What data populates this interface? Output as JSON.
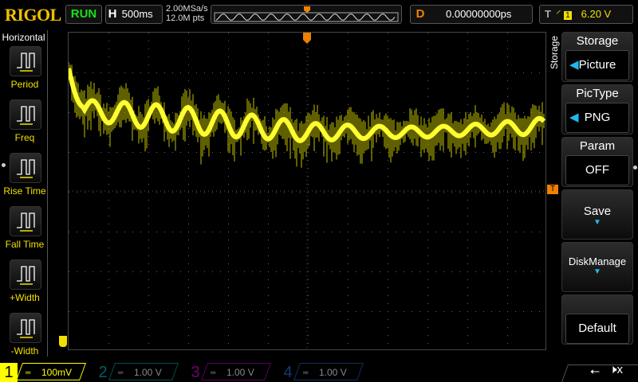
{
  "header": {
    "logo": "RIGOL",
    "run_status": "RUN",
    "timebase_label": "H",
    "timebase": "500ms",
    "sample_rate": "2.00MSa/s",
    "memory_depth": "12.0M pts",
    "delay_label": "D",
    "delay": "0.00000000ps",
    "trigger_label": "T",
    "trigger_edge_icon": "rising-edge-icon",
    "trigger_source": "1",
    "trigger_level": "6.20 V"
  },
  "left_menu": {
    "title": "Horizontal",
    "items": [
      {
        "label": "Period",
        "icon": "period-icon"
      },
      {
        "label": "Freq",
        "icon": "freq-icon"
      },
      {
        "label": "Rise Time",
        "icon": "rise-time-icon"
      },
      {
        "label": "Fall Time",
        "icon": "fall-time-icon"
      },
      {
        "label": "+Width",
        "icon": "positive-width-icon"
      },
      {
        "label": "-Width",
        "icon": "negative-width-icon"
      }
    ]
  },
  "right_menu": {
    "title": "Storage",
    "items": [
      {
        "label": "Storage",
        "value": "Picture",
        "arrow": true
      },
      {
        "label": "PicType",
        "value": "PNG",
        "arrow": true
      },
      {
        "label": "Param",
        "value": "OFF"
      },
      {
        "label": "Save"
      },
      {
        "label": "DiskManage"
      },
      {
        "label": "Default"
      }
    ]
  },
  "markers": {
    "trigger": "T"
  },
  "channels": [
    {
      "num": "1",
      "scale": "100mV",
      "color": "#ffff00",
      "active": true
    },
    {
      "num": "2",
      "scale": "1.00 V",
      "color": "#00a0a0"
    },
    {
      "num": "3",
      "scale": "1.00 V",
      "color": "#c000c0"
    },
    {
      "num": "4",
      "scale": "1.00 V",
      "color": "#2060c0"
    }
  ],
  "colors": {
    "trace": "#ffff00",
    "accent": "#20b8f0",
    "trigger": "#f08000"
  }
}
